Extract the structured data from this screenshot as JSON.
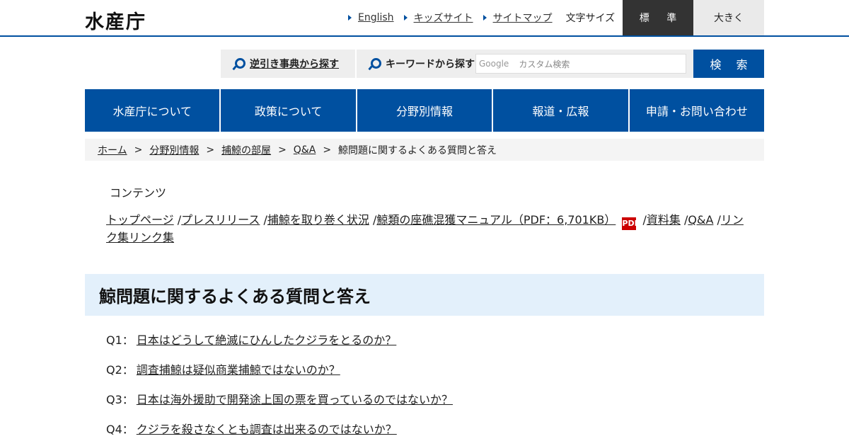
{
  "header": {
    "logo": "水産庁",
    "util_links": [
      "English",
      "キッズサイト",
      "サイトマップ"
    ],
    "font_size_label": "文字サイズ",
    "font_standard": "標 準",
    "font_large": "大きく"
  },
  "search": {
    "reverse_dictionary_label": "逆引き事典から探す",
    "keyword_label": "キーワードから探す",
    "google_label": "Google",
    "input_placeholder": "カスタム検索",
    "button_label": "検 索"
  },
  "gnav": [
    "水産庁について",
    "政策について",
    "分野別情報",
    "報道・広報",
    "申請・お問い合わせ"
  ],
  "breadcrumb": [
    "ホーム",
    "分野別情報",
    "捕鯨の部屋",
    "Q&A",
    "鯨問題に関するよくある質問と答え"
  ],
  "contents": {
    "title": "コンテンツ",
    "links": [
      "トップページ",
      "プレスリリース",
      "捕鯨を取り巻く状況",
      "鯨類の座礁混獲マニュアル（PDF：6,701KB）",
      "資料集",
      "Q&A",
      "リンク集リンク集"
    ],
    "pdf_icon_label": "PDF"
  },
  "page_title": "鯨問題に関するよくある質問と答え",
  "qa": [
    {
      "num": "Q1：",
      "text": "日本はどうして絶滅にひんしたクジラをとるのか？"
    },
    {
      "num": "Q2：",
      "text": "調査捕鯨は疑似商業捕鯨ではないのか？"
    },
    {
      "num": "Q3：",
      "text": "日本は海外援助で開発途上国の票を買っているのではないか？"
    },
    {
      "num": "Q4：",
      "text": "クジラを殺さなくとも調査は出来るのではないか？"
    }
  ]
}
